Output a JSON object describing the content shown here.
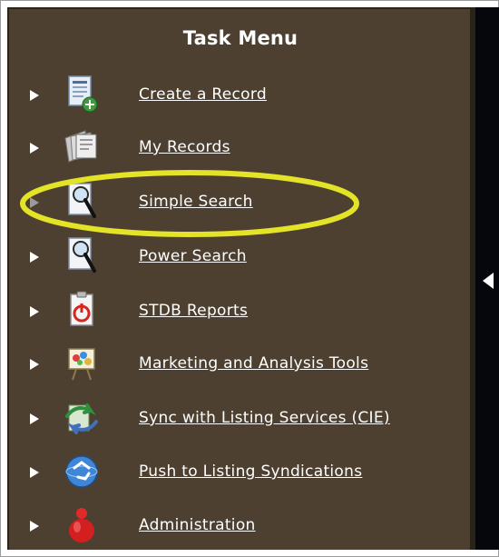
{
  "menu": {
    "title": "Task Menu",
    "items": [
      {
        "label": "Create a Record",
        "icon": "document-add-icon"
      },
      {
        "label": "My Records",
        "icon": "records-stack-icon"
      },
      {
        "label": "Simple Search",
        "icon": "search-document-icon"
      },
      {
        "label": "Power Search",
        "icon": "search-document-icon"
      },
      {
        "label": "STDB Reports",
        "icon": "report-chart-icon"
      },
      {
        "label": "Marketing and Analysis Tools",
        "icon": "analysis-board-icon"
      },
      {
        "label": "Sync with Listing Services (CIE)",
        "icon": "sync-arrows-icon"
      },
      {
        "label": "Push to Listing Syndications",
        "icon": "globe-recycle-icon"
      },
      {
        "label": "Administration",
        "icon": "admin-red-icon"
      }
    ]
  },
  "colors": {
    "panel_background": "#4d4030",
    "text": "#ffffff",
    "highlight_ring": "#e3e327"
  }
}
